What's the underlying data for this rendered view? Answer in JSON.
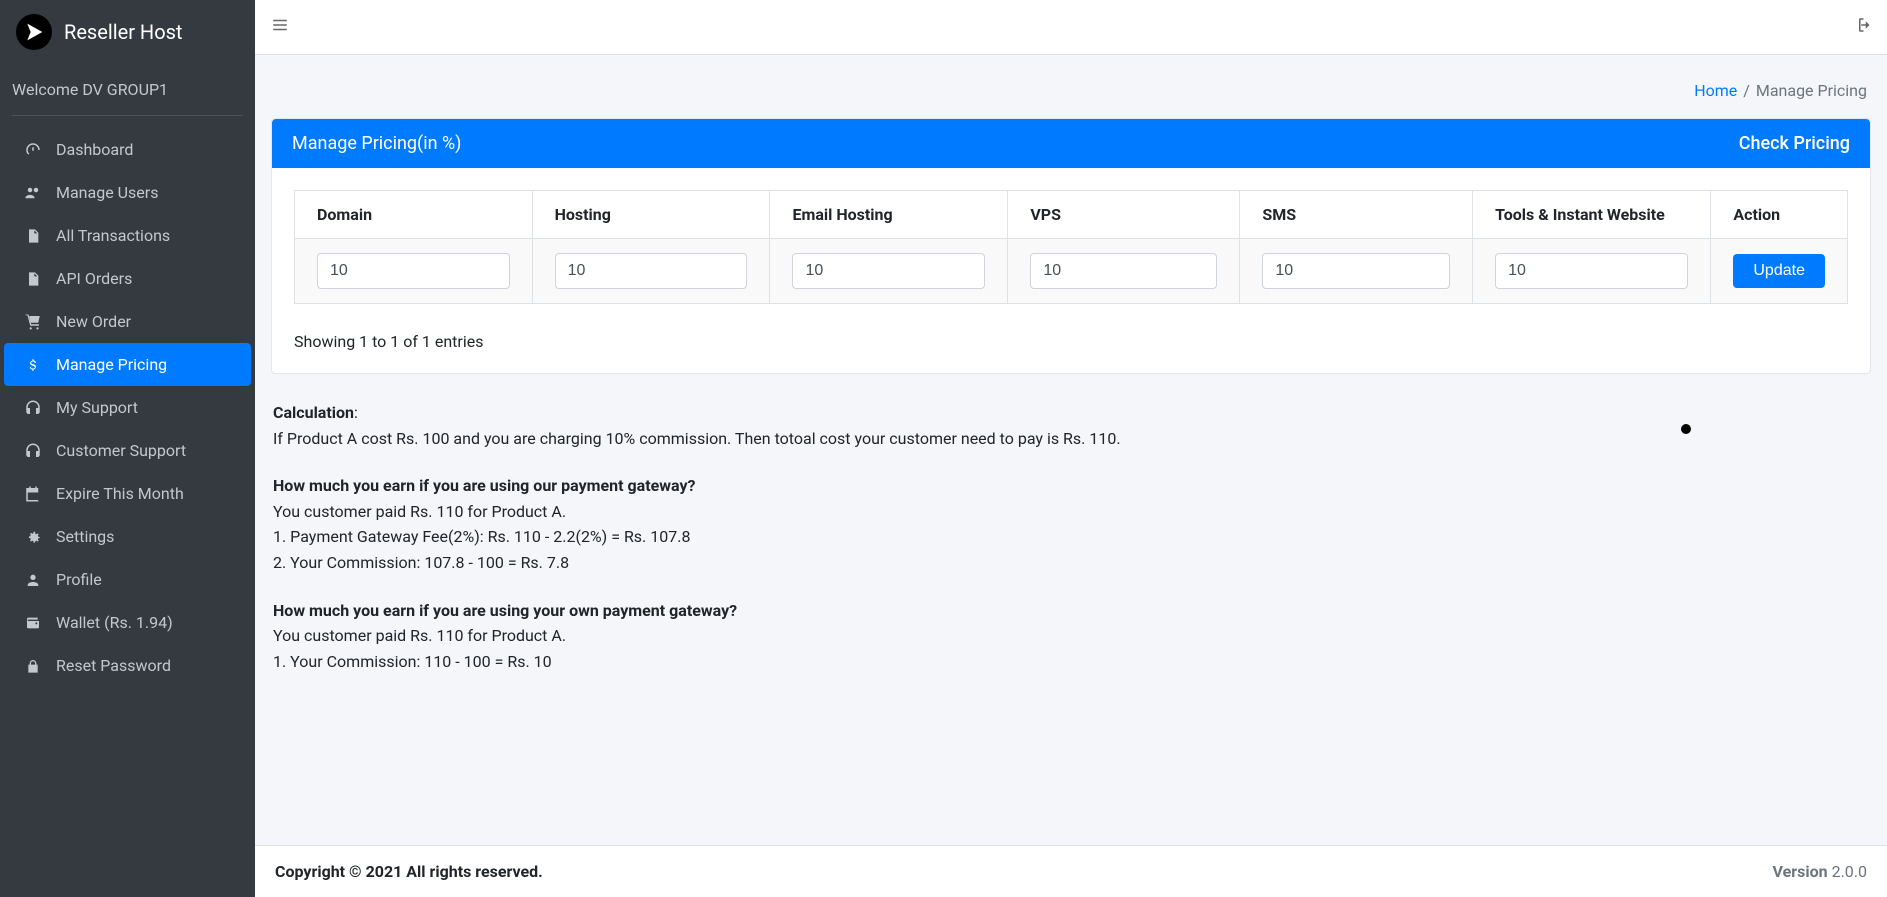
{
  "brand": {
    "name": "Reseller Host"
  },
  "welcome": "Welcome DV GROUP1",
  "sidebar": {
    "items": [
      {
        "label": "Dashboard",
        "icon": "gauge"
      },
      {
        "label": "Manage Users",
        "icon": "users"
      },
      {
        "label": "All Transactions",
        "icon": "file"
      },
      {
        "label": "API Orders",
        "icon": "file"
      },
      {
        "label": "New Order",
        "icon": "cart"
      },
      {
        "label": "Manage Pricing",
        "icon": "dollar",
        "active": true
      },
      {
        "label": "My Support",
        "icon": "headset"
      },
      {
        "label": "Customer Support",
        "icon": "headset"
      },
      {
        "label": "Expire This Month",
        "icon": "calendar"
      },
      {
        "label": "Settings",
        "icon": "cogs"
      },
      {
        "label": "Profile",
        "icon": "user"
      },
      {
        "label": "Wallet (Rs. 1.94)",
        "icon": "wallet"
      },
      {
        "label": "Reset Password",
        "icon": "lock"
      }
    ]
  },
  "breadcrumb": {
    "home": "Home",
    "sep": "/",
    "current": "Manage Pricing"
  },
  "card": {
    "title": "Manage Pricing(in %)",
    "action": "Check Pricing",
    "headers": [
      "Domain",
      "Hosting",
      "Email Hosting",
      "VPS",
      "SMS",
      "Tools & Instant Website",
      "Action"
    ],
    "row": {
      "domain": "10",
      "hosting": "10",
      "email_hosting": "10",
      "vps": "10",
      "sms": "10",
      "tools": "10",
      "button": "Update"
    },
    "info": "Showing 1 to 1 of 1 entries"
  },
  "explain": {
    "h1": "Calculation",
    "h1_colon": ":",
    "l1": "If Product A cost Rs. 100 and you are charging 10% commission. Then totoal cost your customer need to pay is Rs. 110.",
    "h2": "How much you earn if you are using our payment gateway?",
    "l2a": "You customer paid Rs. 110 for Product A.",
    "l2b": "1. Payment Gateway Fee(2%): Rs. 110 - 2.2(2%) = Rs. 107.8",
    "l2c": "2. Your Commission: 107.8 - 100 = Rs. 7.8",
    "h3": "How much you earn if you are using your own payment gateway?",
    "l3a": "You customer paid Rs. 110 for Product A.",
    "l3b": "1. Your Commission: 110 - 100 = Rs. 10"
  },
  "footer": {
    "copyright": "Copyright © 2021 All rights reserved.",
    "version_label": "Version ",
    "version": "2.0.0"
  }
}
